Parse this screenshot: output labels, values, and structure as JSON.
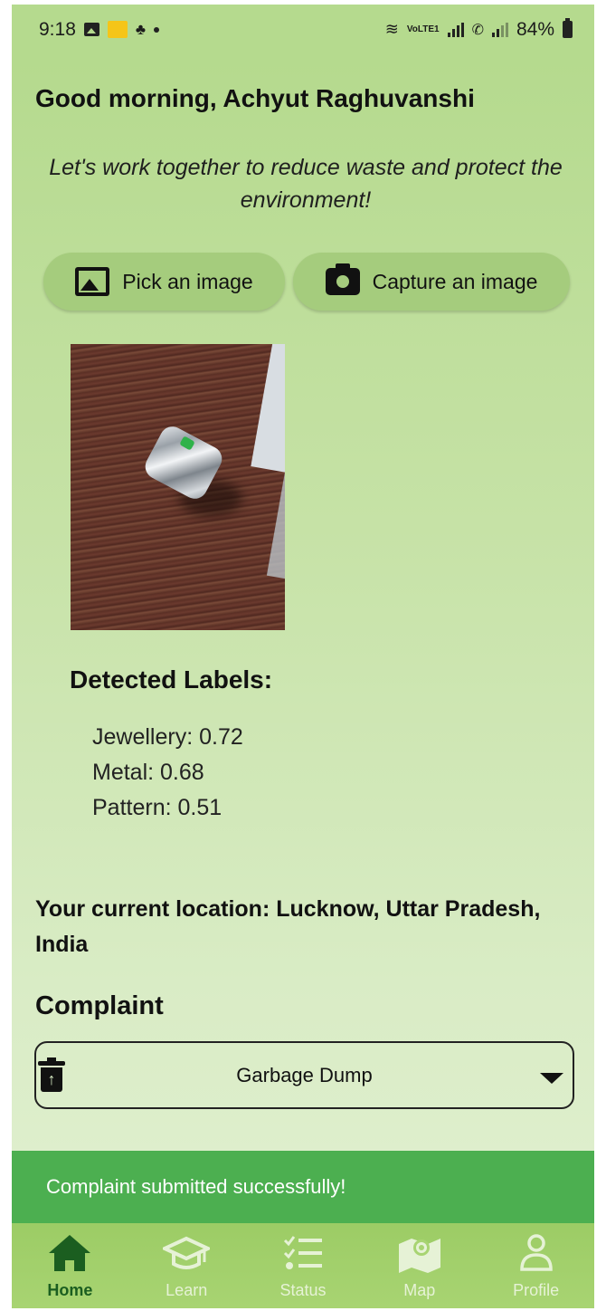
{
  "status_bar": {
    "time": "9:18",
    "network_label": "VoLTE1",
    "battery": "84%"
  },
  "greeting": "Good morning, Achyut Raghuvanshi",
  "tagline": "Let's work together to reduce waste and protect the environment!",
  "buttons": {
    "pick": "Pick an image",
    "capture": "Capture an image"
  },
  "detection": {
    "title": "Detected Labels:",
    "labels": [
      "Jewellery: 0.72",
      "Metal: 0.68",
      "Pattern: 0.51"
    ]
  },
  "location": "Your current location: Lucknow, Uttar Pradesh, India",
  "complaint": {
    "title": "Complaint",
    "selected": "Garbage Dump"
  },
  "snackbar": "Complaint submitted successfully!",
  "nav": {
    "items": [
      {
        "label": "Home",
        "icon": "home-icon",
        "active": true
      },
      {
        "label": "Learn",
        "icon": "graduation-cap-icon",
        "active": false
      },
      {
        "label": "Status",
        "icon": "checklist-icon",
        "active": false
      },
      {
        "label": "Map",
        "icon": "map-icon",
        "active": false
      },
      {
        "label": "Profile",
        "icon": "person-icon",
        "active": false
      }
    ]
  },
  "colors": {
    "accent_dark": "#1b5e20",
    "snackbar": "#4caf50",
    "button_bg": "#a5cc7d",
    "nav_bg": "#9ccc65"
  }
}
